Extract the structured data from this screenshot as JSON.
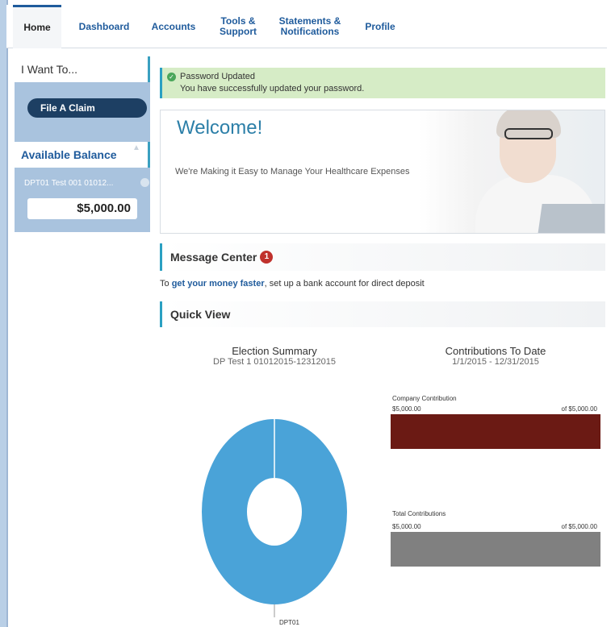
{
  "nav": {
    "items": [
      {
        "label": "Home",
        "active": true
      },
      {
        "label": "Dashboard",
        "active": false
      },
      {
        "label": "Accounts",
        "active": false
      },
      {
        "label": "Tools &\nSupport",
        "active": false
      },
      {
        "label": "Statements &\nNotifications",
        "active": false
      },
      {
        "label": "Profile",
        "active": false
      }
    ]
  },
  "sidebar": {
    "want_title": "I Want To...",
    "claim_button": "File A Claim",
    "balance_title": "Available Balance",
    "account_name": "DPT01 Test 001 01012...",
    "balance_amount": "$5,000.00"
  },
  "alert": {
    "title": "Password Updated",
    "message": "You have successfully updated your password."
  },
  "welcome": {
    "title": "Welcome!",
    "subtitle": "We're Making it Easy to Manage Your Healthcare Expenses"
  },
  "message_center": {
    "title": "Message Center",
    "badge_count": "1",
    "text_prefix": "To ",
    "link_text": "get your money faster",
    "text_suffix": ", set up a bank account for direct deposit"
  },
  "quick_view": {
    "title": "Quick View",
    "election": {
      "title": "Election Summary",
      "subtitle": "DP Test 1 01012015-12312015",
      "slice_label": "DPT01"
    },
    "contributions": {
      "title": "Contributions To Date",
      "subtitle": "1/1/2015 - 12/31/2015",
      "bars": [
        {
          "label": "Company Contribution",
          "amount": "$5,000.00",
          "of": "of $5,000.00",
          "fraction": 1.0,
          "color": "#6b1a14"
        },
        {
          "label": "Total Contributions",
          "amount": "$5,000.00",
          "of": "of $5,000.00",
          "fraction": 1.0,
          "color": "#808080"
        }
      ]
    }
  },
  "colors": {
    "brand_blue": "#1f5b9c",
    "accent_teal": "#2ba0c2",
    "donut_blue": "#4aa3d8"
  }
}
